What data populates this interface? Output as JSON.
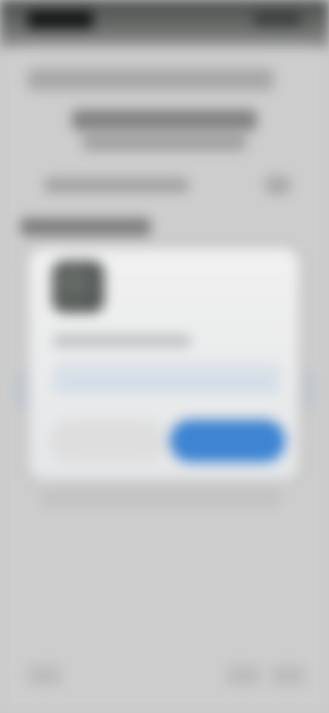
{
  "status_bar": {
    "time": "",
    "icons": [
      "signal-icon",
      "wifi-icon",
      "battery-icon"
    ]
  },
  "sheet": {
    "top_label": "",
    "heading": "",
    "subheading": "",
    "option_label": "",
    "section_label": ""
  },
  "dialog": {
    "app_name": "",
    "description": "",
    "cancel_label": "",
    "confirm_label": ""
  },
  "colors": {
    "accent": "#3d84d2",
    "background": "#c9c9c9",
    "dialog": "#f1f1f1"
  }
}
